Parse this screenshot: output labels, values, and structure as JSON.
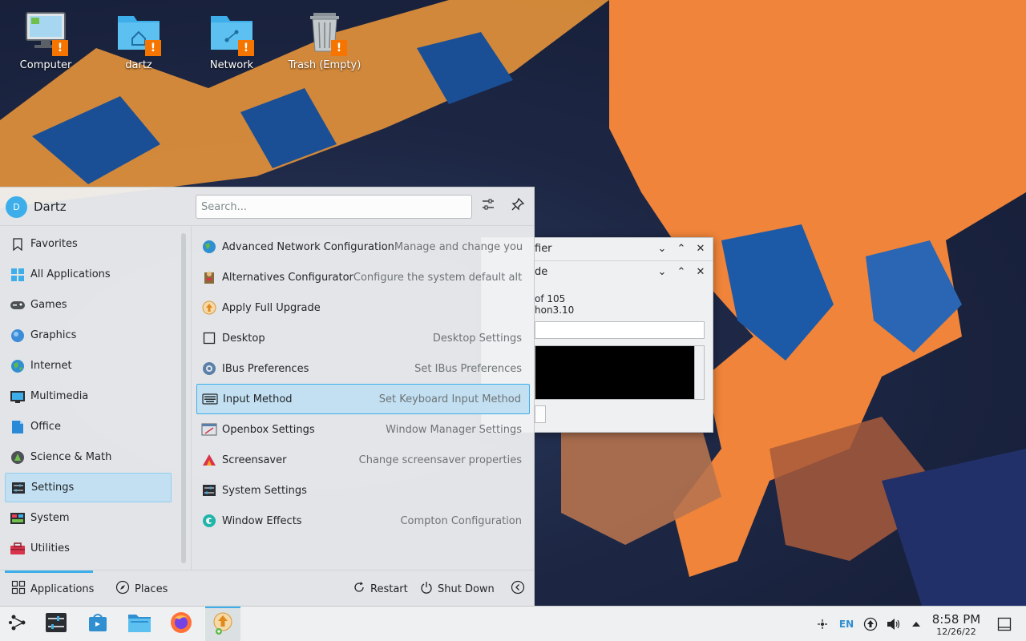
{
  "desktop": {
    "icons": [
      {
        "label": "Computer",
        "icon": "computer-icon"
      },
      {
        "label": "dartz",
        "icon": "home-folder-icon"
      },
      {
        "label": "Network",
        "icon": "network-folder-icon"
      },
      {
        "label": "Trash (Empty)",
        "icon": "trash-icon"
      }
    ]
  },
  "dialogs": {
    "back": {
      "title_fragment": "fier"
    },
    "front": {
      "title_fragment": "de",
      "progress_line1": "of 105",
      "progress_line2": "hon3.10"
    }
  },
  "launcher": {
    "user": {
      "name": "Dartz",
      "initial": "D"
    },
    "search": {
      "placeholder": "Search..."
    },
    "categories": [
      {
        "label": "Favorites",
        "icon": "bookmark-icon"
      },
      {
        "label": "All Applications",
        "icon": "grid-icon"
      },
      {
        "label": "Games",
        "icon": "gamepad-icon"
      },
      {
        "label": "Graphics",
        "icon": "graphics-icon"
      },
      {
        "label": "Internet",
        "icon": "globe-icon"
      },
      {
        "label": "Multimedia",
        "icon": "multimedia-icon"
      },
      {
        "label": "Office",
        "icon": "office-icon"
      },
      {
        "label": "Science & Math",
        "icon": "science-icon"
      },
      {
        "label": "Settings",
        "icon": "settings-icon",
        "selected": true
      },
      {
        "label": "System",
        "icon": "system-icon"
      },
      {
        "label": "Utilities",
        "icon": "toolbox-icon"
      }
    ],
    "apps": [
      {
        "name": "Advanced Network Configuration",
        "desc": "Manage and change your...",
        "icon": "network-config-icon"
      },
      {
        "name": "Alternatives Configurator",
        "desc": "Configure the system default alte...",
        "icon": "alternatives-icon"
      },
      {
        "name": "Apply Full Upgrade",
        "desc": "",
        "icon": "upgrade-icon"
      },
      {
        "name": "Desktop",
        "desc": "Desktop Settings",
        "icon": "desktop-icon"
      },
      {
        "name": "IBus Preferences",
        "desc": "Set IBus Preferences",
        "icon": "ibus-icon"
      },
      {
        "name": "Input Method",
        "desc": "Set Keyboard Input Method",
        "icon": "keyboard-icon",
        "selected": true
      },
      {
        "name": "Openbox Settings",
        "desc": "Window Manager Settings",
        "icon": "openbox-icon"
      },
      {
        "name": "Screensaver",
        "desc": "Change screensaver properties",
        "icon": "screensaver-icon"
      },
      {
        "name": "System Settings",
        "desc": "",
        "icon": "system-settings-icon"
      },
      {
        "name": "Window Effects",
        "desc": "Compton Configuration",
        "icon": "window-effects-icon"
      }
    ],
    "footer": {
      "applications_tab": "Applications",
      "places_tab": "Places",
      "restart": "Restart",
      "shutdown": "Shut Down"
    }
  },
  "taskbar": {
    "tray": {
      "language": "EN"
    },
    "clock": {
      "time": "8:58 PM",
      "date": "12/26/22"
    }
  },
  "colors": {
    "accent": "#3daee9",
    "warning": "#f67400",
    "panel": "#eff0f1"
  }
}
